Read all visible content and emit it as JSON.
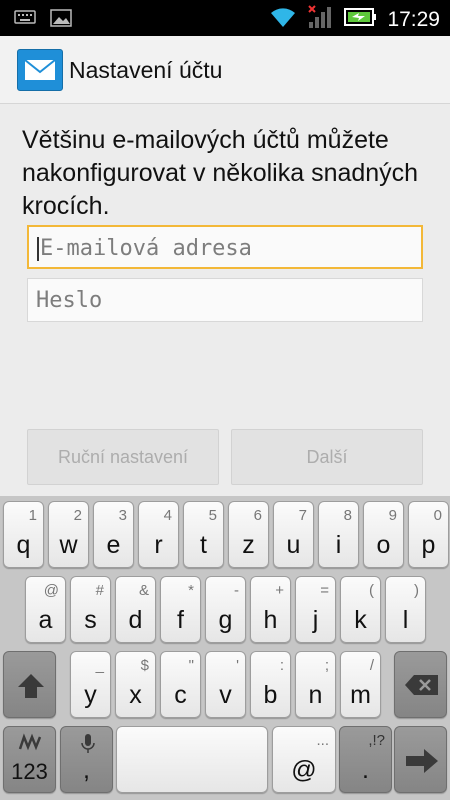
{
  "status_bar": {
    "time": "17:29",
    "icons": [
      "keyboard-icon",
      "image-icon",
      "wifi-icon",
      "signal-icon",
      "battery-icon"
    ]
  },
  "action_bar": {
    "title": "Nastavení účtu",
    "icon": "mail-icon"
  },
  "setup": {
    "intro": "Většinu e-mailových účtů můžete nakonfigurovat v několika snadných krocích.",
    "email_placeholder": "E-mailová adresa",
    "password_placeholder": "Heslo",
    "manual_button": "Ruční nastavení",
    "next_button": "Další"
  },
  "keyboard": {
    "row1": [
      {
        "main": "q",
        "sub": "1"
      },
      {
        "main": "w",
        "sub": "2"
      },
      {
        "main": "e",
        "sub": "3"
      },
      {
        "main": "r",
        "sub": "4"
      },
      {
        "main": "t",
        "sub": "5"
      },
      {
        "main": "z",
        "sub": "6"
      },
      {
        "main": "u",
        "sub": "7"
      },
      {
        "main": "i",
        "sub": "8"
      },
      {
        "main": "o",
        "sub": "9"
      },
      {
        "main": "p",
        "sub": "0"
      }
    ],
    "row2": [
      {
        "main": "a",
        "sub": "@"
      },
      {
        "main": "s",
        "sub": "#"
      },
      {
        "main": "d",
        "sub": "&"
      },
      {
        "main": "f",
        "sub": "*"
      },
      {
        "main": "g",
        "sub": "-"
      },
      {
        "main": "h",
        "sub": "+"
      },
      {
        "main": "j",
        "sub": "="
      },
      {
        "main": "k",
        "sub": "("
      },
      {
        "main": "l",
        "sub": ")"
      }
    ],
    "row3": [
      {
        "main": "y",
        "sub": "_"
      },
      {
        "main": "x",
        "sub": "$"
      },
      {
        "main": "c",
        "sub": "\""
      },
      {
        "main": "v",
        "sub": "'"
      },
      {
        "main": "b",
        "sub": ":"
      },
      {
        "main": "n",
        "sub": ";"
      },
      {
        "main": "m",
        "sub": "/"
      }
    ],
    "symbols_label": "123",
    "comma": ",",
    "at": "@",
    "dots": "...",
    "period": ".",
    "period_sub": ",!?"
  }
}
